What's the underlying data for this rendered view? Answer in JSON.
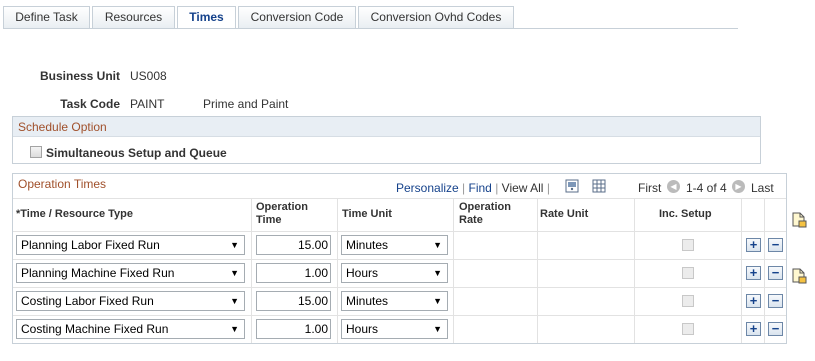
{
  "tabs": [
    {
      "label": "Define Task",
      "active": false
    },
    {
      "label": "Resources",
      "active": false
    },
    {
      "label": "Times",
      "active": true
    },
    {
      "label": "Conversion Code",
      "active": false
    },
    {
      "label": "Conversion Ovhd Codes",
      "active": false
    }
  ],
  "header": {
    "business_unit_label": "Business Unit",
    "business_unit_value": "US008",
    "task_code_label": "Task Code",
    "task_code_value": "PAINT",
    "task_code_desc": "Prime and Paint"
  },
  "schedule_option": {
    "title": "Schedule Option",
    "checkbox_label": "Simultaneous Setup and Queue",
    "checked": false
  },
  "grid": {
    "title": "Operation Times",
    "personalize": "Personalize",
    "find": "Find",
    "sep1": "|",
    "view_all": "View All",
    "sep2": "|",
    "first": "First",
    "range": "1-4 of 4",
    "last": "Last",
    "columns": {
      "time_type": "*Time / Resource Type",
      "op_time_1": "Operation",
      "op_time_2": "Time",
      "time_unit": "Time Unit",
      "op_rate_1": "Operation",
      "op_rate_2": "Rate",
      "rate_unit": "Rate Unit",
      "inc_setup": "Inc. Setup"
    },
    "rows": [
      {
        "type": "Planning Labor Fixed Run",
        "time": "15.00",
        "unit": "Minutes"
      },
      {
        "type": "Planning Machine Fixed Run",
        "time": "1.00",
        "unit": "Hours"
      },
      {
        "type": "Costing Labor Fixed Run",
        "time": "15.00",
        "unit": "Minutes"
      },
      {
        "type": "Costing Machine Fixed Run",
        "time": "1.00",
        "unit": "Hours"
      }
    ],
    "add_symbol": "+",
    "remove_symbol": "−"
  },
  "icons": {
    "nav_prev": "prev-arrow-icon",
    "nav_next": "next-arrow-icon",
    "zoom": "zoom-icon",
    "download": "download-excel-icon",
    "side": "attachment-page-icon"
  },
  "colors": {
    "section_title": "#a0502b",
    "link": "#15428b",
    "border": "#c7d0d8"
  }
}
